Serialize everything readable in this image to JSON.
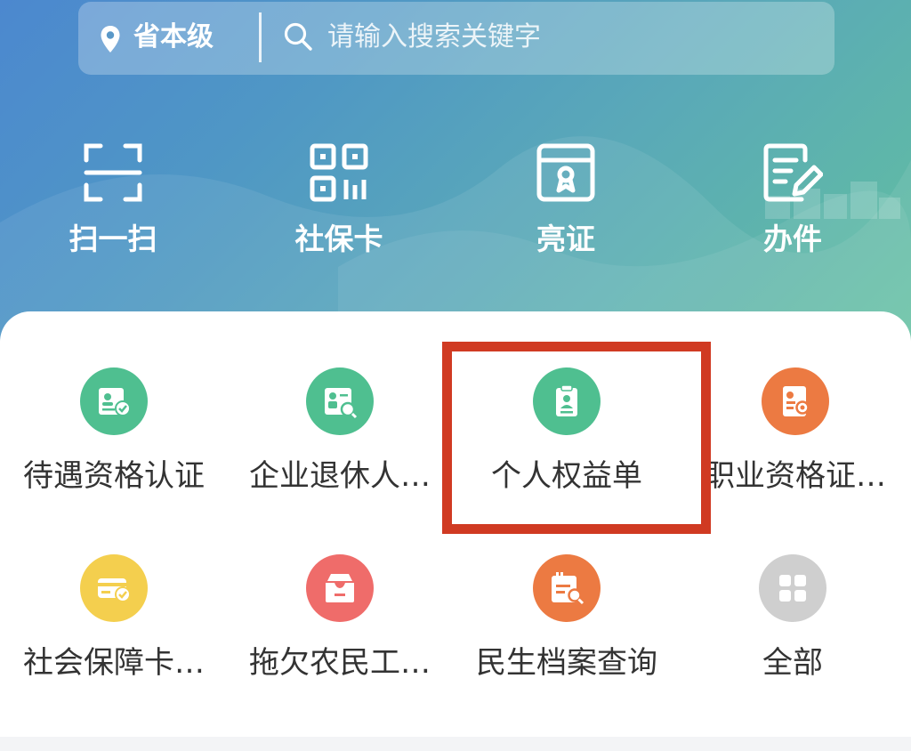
{
  "search": {
    "location": "省本级",
    "placeholder": "请输入搜索关键字"
  },
  "quick_actions": [
    {
      "label": "扫一扫",
      "icon": "scan-icon"
    },
    {
      "label": "社保卡",
      "icon": "qr-code-icon"
    },
    {
      "label": "亮证",
      "icon": "certificate-icon"
    },
    {
      "label": "办件",
      "icon": "edit-document-icon"
    }
  ],
  "services": [
    {
      "label": "待遇资格认证",
      "icon": "id-card-check-icon",
      "color": "#4fbf90"
    },
    {
      "label": "企业退休人…",
      "icon": "id-card-search-icon",
      "color": "#4fbf90"
    },
    {
      "label": "个人权益单",
      "icon": "clipboard-user-icon",
      "color": "#4fbf90"
    },
    {
      "label": "职业资格证…",
      "icon": "certificate-search-icon",
      "color": "#ec7a42"
    },
    {
      "label": "社会保障卡…",
      "icon": "card-check-icon",
      "color": "#f4cf4e"
    },
    {
      "label": "拖欠农民工…",
      "icon": "inbox-icon",
      "color": "#ef6c6a"
    },
    {
      "label": "民生档案查询",
      "icon": "archive-search-icon",
      "color": "#ec7a42"
    },
    {
      "label": "全部",
      "icon": "grid-icon",
      "color": "#cfcfcf"
    }
  ],
  "colors": {
    "highlight": "#d03a22",
    "green": "#4fbf90",
    "orange": "#ec7a42",
    "yellow": "#f4cf4e",
    "red": "#ef6c6a",
    "gray": "#cfcfcf"
  }
}
